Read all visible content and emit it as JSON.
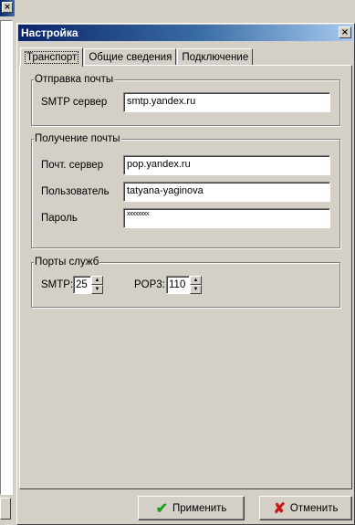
{
  "background_window": {
    "close_glyph": "×"
  },
  "dialog": {
    "title": "Настройка",
    "close_glyph": "×"
  },
  "tabs": [
    {
      "label": "Транспорт",
      "active": true
    },
    {
      "label": "Общие сведения",
      "active": false
    },
    {
      "label": "Подключение",
      "active": false
    }
  ],
  "outgoing": {
    "legend": "Отправка почты",
    "smtp_label": "SMTP сервер",
    "smtp_value": "smtp.yandex.ru"
  },
  "incoming": {
    "legend": "Получение почты",
    "server_label": "Почт. сервер",
    "server_value": "pop.yandex.ru",
    "user_label": "Пользователь",
    "user_value": "tatyana-yaginova",
    "password_label": "Пароль",
    "password_value": "xxxxxxxx"
  },
  "ports": {
    "legend": "Порты служб",
    "smtp_label": "SMTP:",
    "smtp_value": "25",
    "pop3_label": "POP3:",
    "pop3_value": "110",
    "up_glyph": "▲",
    "down_glyph": "▼"
  },
  "buttons": {
    "apply_label": "Применить",
    "apply_icon": "✔",
    "cancel_label": "Отменить",
    "cancel_icon": "✘"
  },
  "colors": {
    "title_bar": "#0a246a",
    "face": "#d4d0c8",
    "apply_icon": "#1e9e1e",
    "cancel_icon": "#c41a1a"
  }
}
